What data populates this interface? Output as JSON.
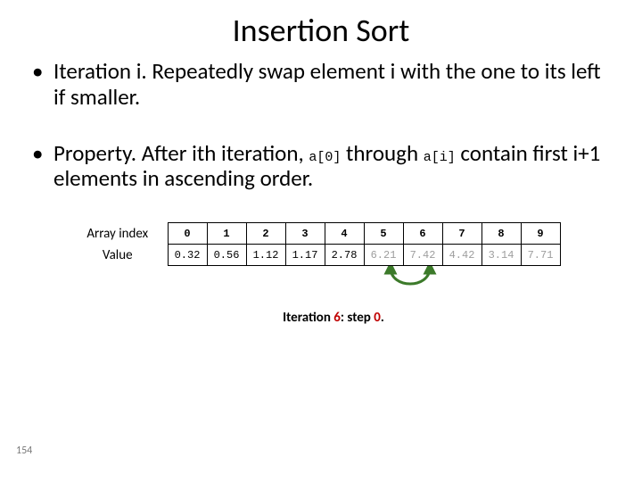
{
  "title": "Insertion Sort",
  "bullet1_a": "Iteration i.  Repeatedly swap element i with the one to its left if smaller.",
  "bullet2_a": "Property.  After ith iteration, ",
  "bullet2_code1": "a[0]",
  "bullet2_b": " through ",
  "bullet2_code2": "a[i]",
  "bullet2_c": " contain first i+1 elements in ascending order.",
  "row_index_label": "Array index",
  "row_value_label": "Value",
  "idx": [
    "0",
    "1",
    "2",
    "3",
    "4",
    "5",
    "6",
    "7",
    "8",
    "9"
  ],
  "val": [
    "0.32",
    "0.56",
    "1.12",
    "1.17",
    "2.78",
    "6.21",
    "7.42",
    "4.42",
    "3.14",
    "7.71"
  ],
  "caption_a": "Iteration ",
  "caption_iter": "6",
  "caption_b": ": step ",
  "caption_step": "0",
  "caption_c": ".",
  "page": "154",
  "chart_data": {
    "type": "table",
    "title": "Insertion Sort iteration 6 step 0",
    "columns": [
      "Array index",
      "Value"
    ],
    "index": [
      0,
      1,
      2,
      3,
      4,
      5,
      6,
      7,
      8,
      9
    ],
    "values": [
      0.32,
      0.56,
      1.12,
      1.17,
      2.78,
      6.21,
      7.42,
      4.42,
      3.14,
      7.71
    ],
    "sorted_through_index": 5,
    "swap_arrow": {
      "from": 5,
      "to": 6
    }
  }
}
